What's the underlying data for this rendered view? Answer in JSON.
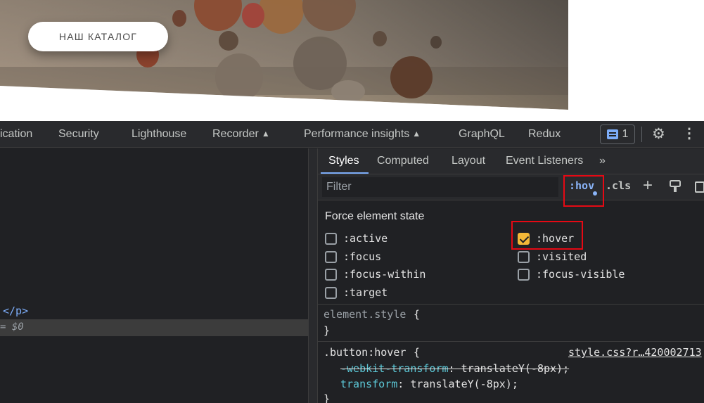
{
  "page": {
    "catalog_button": "НАШ КАТАЛОГ"
  },
  "devtools": {
    "main_tabs": [
      "ication",
      "Security",
      "Lighthouse",
      "Recorder",
      "Performance insights",
      "GraphQL",
      "Redux"
    ],
    "issues_count": "1",
    "dom": {
      "closing_tag": "</p>",
      "selected_suffix": "= $0"
    },
    "styles_tabs": [
      "Styles",
      "Computed",
      "Layout",
      "Event Listeners",
      "»"
    ],
    "filter_placeholder": "Filter",
    "hov_label": ":hov",
    "cls_label": ".cls",
    "plus_label": "+",
    "force_state": {
      "title": "Force element state",
      "states": [
        {
          "label": ":active",
          "checked": false
        },
        {
          "label": ":hover",
          "checked": true
        },
        {
          "label": ":focus",
          "checked": false
        },
        {
          "label": ":visited",
          "checked": false
        },
        {
          "label": ":focus-within",
          "checked": false
        },
        {
          "label": ":focus-visible",
          "checked": false
        },
        {
          "label": ":target",
          "checked": false
        }
      ]
    },
    "rules": {
      "element_style_selector": "element.style",
      "open_brace": "{",
      "close_brace": "}",
      "button_hover_selector": ".button:hover",
      "source_link": "style.css?r…420002713",
      "decl1_prop": "-webkit-transform",
      "decl1_value": "translateY(-8px);",
      "decl2_prop": "transform",
      "decl2_value": "translateY(-8px);",
      "colon": ":"
    }
  },
  "colors": {
    "accent_blue": "#8ab4f8",
    "checkbox_checked": "#f3b838",
    "highlight_red": "#e50914",
    "css_property": "#5cc8d7"
  }
}
